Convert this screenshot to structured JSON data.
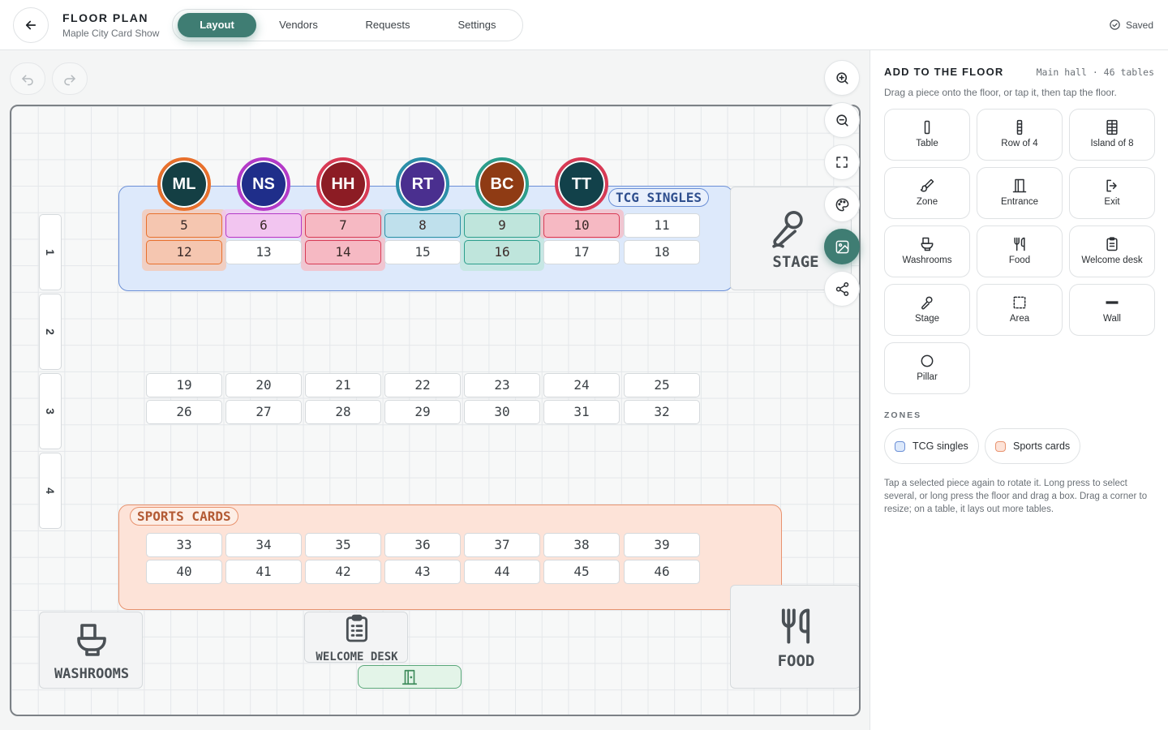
{
  "header": {
    "title": "FLOOR PLAN",
    "subtitle": "Maple City Card Show",
    "tabs": [
      {
        "label": "Layout",
        "active": true
      },
      {
        "label": "Vendors",
        "active": false
      },
      {
        "label": "Requests",
        "active": false
      },
      {
        "label": "Settings",
        "active": false
      }
    ],
    "status": "Saved",
    "accent": "#3f7d73"
  },
  "floor": {
    "zones": [
      {
        "label": "TCG SINGLES",
        "color": "#6b8fd6"
      },
      {
        "label": "SPORTS CARDS",
        "color": "#e8936f"
      }
    ],
    "vendors": [
      {
        "initials": "ML",
        "ring": "#e8702c",
        "fill": "#143f44",
        "tables": [
          "5",
          "12"
        ],
        "tint": "#f5c6b0"
      },
      {
        "initials": "NS",
        "ring": "#b43ac8",
        "fill": "#1f2e8a",
        "tables": [
          "6"
        ],
        "tint": "#f2c5f0"
      },
      {
        "initials": "HH",
        "ring": "#d83a55",
        "fill": "#8c1c24",
        "tables": [
          "7",
          "14"
        ],
        "tint": "#f6b9c3"
      },
      {
        "initials": "RT",
        "ring": "#2b8fa8",
        "fill": "#4a2f8f",
        "tables": [
          "8"
        ],
        "tint": "#bfe0ec"
      },
      {
        "initials": "BC",
        "ring": "#2c9e8c",
        "fill": "#8f3b14",
        "tables": [
          "9",
          "16"
        ],
        "tint": "#bfe5dc"
      },
      {
        "initials": "TT",
        "ring": "#d83a55",
        "fill": "#12414a",
        "tables": [
          "10"
        ],
        "tint": "#f6b9c3"
      }
    ],
    "table_rows": [
      [
        "5",
        "6",
        "7",
        "8",
        "9",
        "10",
        "11"
      ],
      [
        "12",
        "13",
        "14",
        "15",
        "16",
        "17",
        "18"
      ],
      [
        "19",
        "20",
        "21",
        "22",
        "23",
        "24",
        "25"
      ],
      [
        "26",
        "27",
        "28",
        "29",
        "30",
        "31",
        "32"
      ],
      [
        "33",
        "34",
        "35",
        "36",
        "37",
        "38",
        "39"
      ],
      [
        "40",
        "41",
        "42",
        "43",
        "44",
        "45",
        "46"
      ]
    ],
    "row_labels": [
      "1",
      "2",
      "3",
      "4"
    ],
    "fixtures": {
      "stage": "STAGE",
      "washrooms": "WASHROOMS",
      "welcome_desk": "WELCOME DESK",
      "food": "FOOD"
    }
  },
  "panel": {
    "title": "ADD TO THE FLOOR",
    "meta": "Main hall · 46 tables",
    "hint": "Drag a piece onto the floor, or tap it, then tap the floor.",
    "pieces": [
      {
        "label": "Table",
        "icon": "table-icon"
      },
      {
        "label": "Row of 4",
        "icon": "row-of-4-icon"
      },
      {
        "label": "Island of 8",
        "icon": "island-icon"
      },
      {
        "label": "Zone",
        "icon": "brush-icon"
      },
      {
        "label": "Entrance",
        "icon": "door-icon"
      },
      {
        "label": "Exit",
        "icon": "exit-icon"
      },
      {
        "label": "Washrooms",
        "icon": "toilet-icon"
      },
      {
        "label": "Food",
        "icon": "utensils-icon"
      },
      {
        "label": "Welcome desk",
        "icon": "clipboard-icon"
      },
      {
        "label": "Stage",
        "icon": "microphone-icon"
      },
      {
        "label": "Area",
        "icon": "dashed-square-icon"
      },
      {
        "label": "Wall",
        "icon": "wall-icon"
      },
      {
        "label": "Pillar",
        "icon": "circle-icon"
      }
    ],
    "zones_heading": "ZONES",
    "zone_chips": [
      {
        "label": "TCG singles",
        "color": "#6b8fd6",
        "fill": "#dde9fb"
      },
      {
        "label": "Sports cards",
        "color": "#e8936f",
        "fill": "#fde3d8"
      }
    ],
    "footer": "Tap a selected piece again to rotate it. Long press to select several, or long press the floor and drag a box. Drag a corner to resize; on a table, it lays out more tables."
  }
}
